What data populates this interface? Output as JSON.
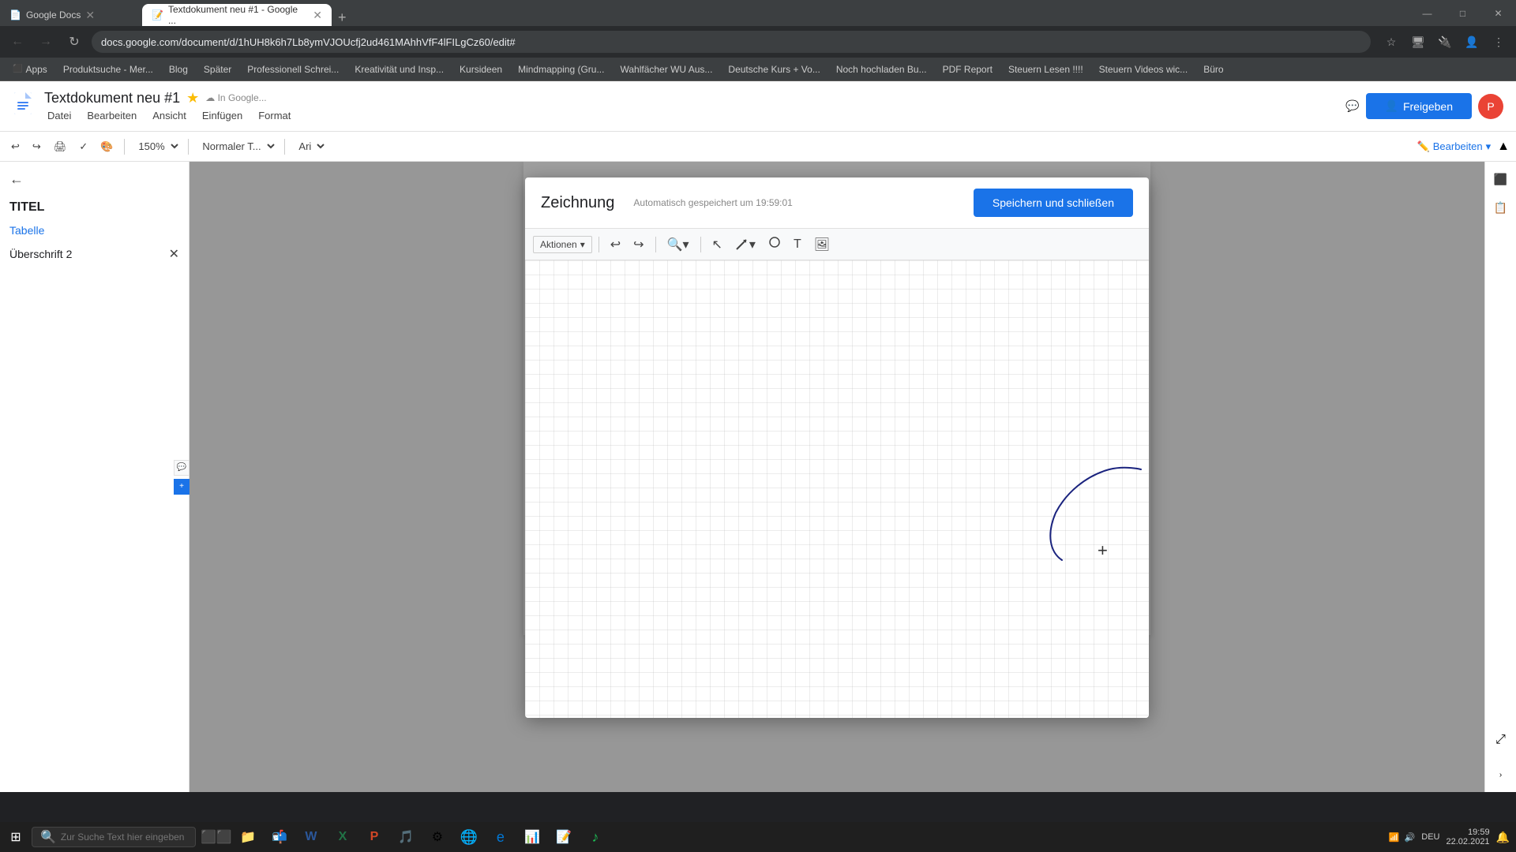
{
  "browser": {
    "tabs": [
      {
        "id": "tab-google-docs",
        "label": "Google Docs",
        "active": false,
        "icon": "📄"
      },
      {
        "id": "tab-textdoc",
        "label": "Textdokument neu #1 - Google ...",
        "active": true,
        "icon": "📝"
      }
    ],
    "address": "docs.google.com/document/d/1hUH8k6h7Lb8ymVJOUcfj2ud461MAhhVfF4lFILgCz60/edit#",
    "new_tab_label": "+"
  },
  "window_controls": {
    "minimize": "—",
    "maximize": "□",
    "close": "✕"
  },
  "bookmarks": [
    {
      "label": "Apps"
    },
    {
      "label": "Produktsuche - Mer..."
    },
    {
      "label": "Blog"
    },
    {
      "label": "Später"
    },
    {
      "label": "Professionell Schrei..."
    },
    {
      "label": "Kreativität und Insp..."
    },
    {
      "label": "Kursideen"
    },
    {
      "label": "Mindmapping (Gru..."
    },
    {
      "label": "Wahlfächer WU Aus..."
    },
    {
      "label": "Deutsche Kurs + Vo..."
    },
    {
      "label": "Noch hochladen Bu..."
    },
    {
      "label": "PDF Report"
    },
    {
      "label": "Steuern Lesen !!!!"
    },
    {
      "label": "Steuern Videos wic..."
    },
    {
      "label": "Büro"
    }
  ],
  "docs": {
    "title": "Textdokument neu #1",
    "menu": [
      "Datei",
      "Bearbeiten",
      "Ansicht",
      "Einfügen",
      "Format",
      ""
    ],
    "toolbar": {
      "zoom": "150%",
      "style": "Normaler T...",
      "font": "Ari"
    },
    "sidebar": {
      "title": "TITEL",
      "items": [
        {
          "label": "Tabelle",
          "level": 1
        },
        {
          "label": "Überschrift 2",
          "level": 2
        }
      ]
    },
    "share_btn": "Freigeben",
    "edit_btn": "Bearbeiten"
  },
  "drawing_dialog": {
    "title": "Zeichnung",
    "autosave": "Automatisch gespeichert um 19:59:01",
    "save_btn": "Speichern und schließen",
    "toolbar": {
      "actions_label": "Aktionen",
      "undo": "↩",
      "redo": "↪"
    }
  },
  "taskbar": {
    "search_placeholder": "Zur Suche Text hier eingeben",
    "time": "19:59",
    "date": "22.02.2021",
    "language": "DEU"
  }
}
